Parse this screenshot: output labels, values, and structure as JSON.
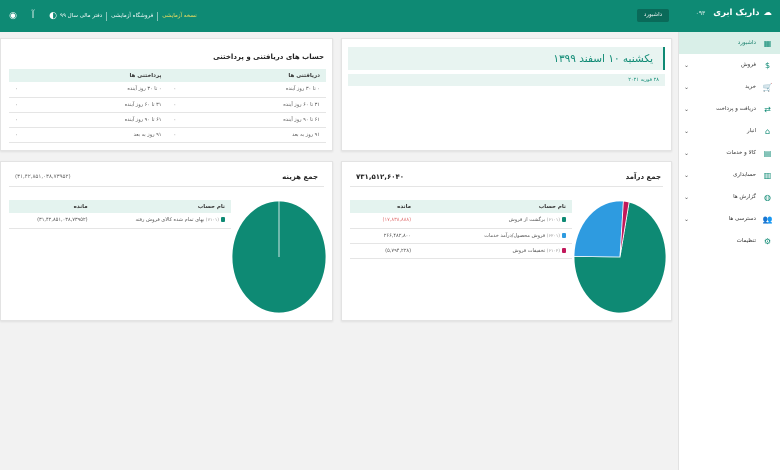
{
  "topbar": {
    "brand": "داریک ابری",
    "version": "۰۹۳",
    "dashboard_button": "داشبورد",
    "fiscal_year": "دفتر مالی سال ۹۹",
    "store": "فروشگاه آزمایشی",
    "test_version": "نسخه آزمایشی",
    "font_label": "آ",
    "bg_color": "#0e8a74"
  },
  "sidebar": {
    "items": [
      {
        "label": "داشبورد",
        "icon": "dashboard-icon",
        "glyph": "▦",
        "chevron": ""
      },
      {
        "label": "فروش",
        "icon": "sales-icon",
        "glyph": "$",
        "chevron": "⌄"
      },
      {
        "label": "خرید",
        "icon": "cart-icon",
        "glyph": "🛒",
        "chevron": "⌄"
      },
      {
        "label": "دریافت و پرداخت",
        "icon": "transfer-icon",
        "glyph": "⇄",
        "chevron": "⌄"
      },
      {
        "label": "انبار",
        "icon": "warehouse-icon",
        "glyph": "⌂",
        "chevron": "⌄"
      },
      {
        "label": "کالا و خدمات",
        "icon": "goods-icon",
        "glyph": "▤",
        "chevron": "⌄"
      },
      {
        "label": "حسابداری",
        "icon": "accounting-icon",
        "glyph": "▥",
        "chevron": "⌄"
      },
      {
        "label": "گزارش ها",
        "icon": "reports-icon",
        "glyph": "◍",
        "chevron": "⌄"
      },
      {
        "label": "دسترسی ها",
        "icon": "users-icon",
        "glyph": "👥",
        "chevron": "⌄"
      },
      {
        "label": "تنظیمات",
        "icon": "settings-icon",
        "glyph": "⚙",
        "chevron": ""
      }
    ]
  },
  "date_panel": {
    "date": "یکشنبه ۱۰ اسفند ۱۳۹۹",
    "sub": "۲۸ فوریه ۲۰۲۱"
  },
  "receivables": {
    "title": "حساب های دریافتنی و پرداختنی",
    "col_receivable": "دریافتنی ها",
    "col_payable": "پرداختنی ها",
    "rows": [
      {
        "recv_label": "۰ تا ۳۰ روز آینده",
        "recv": "۰",
        "pay_label": "۰ تا ۳۰ روز آینده",
        "pay": "۰"
      },
      {
        "label_note": "",
        "recv_label": "۳۱ تا ۶۰ روز آینده",
        "recv": "۰",
        "pay_label": "۳۱ تا ۶۰ روز آینده",
        "pay": "۰"
      },
      {
        "recv_label": "۶۱ تا ۹۰ روز آینده",
        "recv": "۰",
        "pay_label": "۶۱ تا ۹۰ روز آینده",
        "pay": "۰"
      },
      {
        "recv_label": "۹۱ روز به بعد",
        "recv": "۰",
        "pay_label": "۹۱ روز به بعد",
        "pay": "۰"
      }
    ]
  },
  "income": {
    "title": "جمع درآمد",
    "total": "۷۳۱,۵۱۲,۶۰۴۰",
    "col_account": "نام حساب",
    "col_balance": "مانده",
    "colors": [
      "#0e8a74",
      "#2e9be0",
      "#c2185b"
    ],
    "rows": [
      {
        "code": "(۶۱۰۱)",
        "name": "برگشت از فروش",
        "balance": "(۱۷,۸۳۸,۸۸۸)",
        "negative": true
      },
      {
        "code": "(۶۲۰۱)",
        "name": "فروش محصول/درآمد خدمات",
        "balance": "۲۶۶,۴۸۲,۸۰۰",
        "negative": false
      },
      {
        "code": "(۶۱۰۲)",
        "name": "تخفیفات فروش",
        "balance": "(۵,۷۹۴,۲۲۸)",
        "negative": false
      }
    ],
    "pie": [
      {
        "name": "برگشت از فروش",
        "value": 72
      },
      {
        "name": "فروش محصول/درآمد خدمات",
        "value": 26
      },
      {
        "name": "تخفیفات فروش",
        "value": 2
      }
    ]
  },
  "expense": {
    "title": "جمع هزینه",
    "total": "(۳۱,۴۲,۸۵۱,۰۳۸,۷۳۹۵۲)",
    "col_account": "نام حساب",
    "col_balance": "مانده",
    "color": "#0e8a74",
    "rows": [
      {
        "code": "(۷۱۰۱)",
        "name": "بهای تمام شده کالای فروش رفته",
        "balance": "(۳۱,۴۲,۸۵۱,۰۳۸,۷۳۹۵۲)"
      }
    ],
    "pie": [
      {
        "name": "بهای تمام شده کالای فروش رفته",
        "value": 100
      }
    ]
  }
}
